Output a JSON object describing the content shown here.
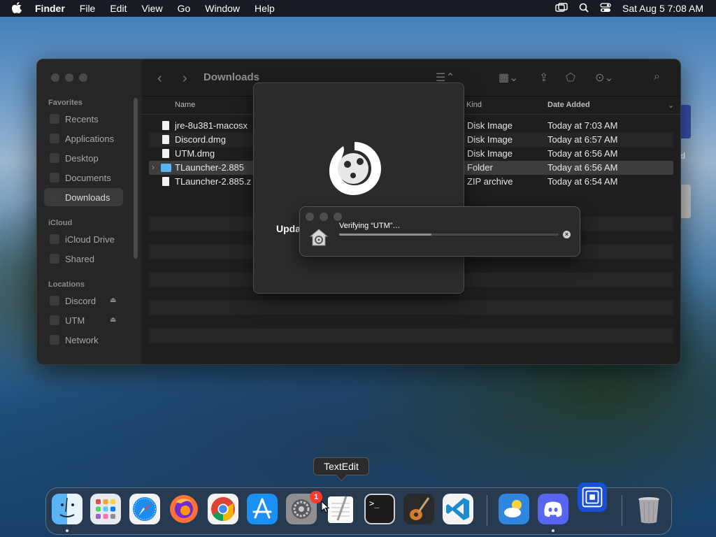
{
  "menubar": {
    "app": "Finder",
    "items": [
      "File",
      "Edit",
      "View",
      "Go",
      "Window",
      "Help"
    ],
    "clock": "Sat Aug 5  7:08 AM"
  },
  "finder": {
    "title": "Downloads",
    "sidebar": {
      "favorites_header": "Favorites",
      "favorites": [
        "Recents",
        "Applications",
        "Desktop",
        "Documents",
        "Downloads"
      ],
      "icloud_header": "iCloud",
      "icloud": [
        "iCloud Drive",
        "Shared"
      ],
      "locations_header": "Locations",
      "locations": [
        "Discord",
        "UTM",
        "Network"
      ]
    },
    "columns": {
      "name": "Name",
      "kind": "Kind",
      "date": "Date Added"
    },
    "files": [
      {
        "name": "jre-8u381-macosx",
        "kind": "Disk Image",
        "date": "Today at 7:03 AM"
      },
      {
        "name": "Discord.dmg",
        "kind": "Disk Image",
        "date": "Today at 6:57 AM"
      },
      {
        "name": "UTM.dmg",
        "kind": "Disk Image",
        "date": "Today at 6:56 AM"
      },
      {
        "name": "TLauncher-2.885",
        "kind": "Folder",
        "date": "Today at 6:56 AM"
      },
      {
        "name": "TLauncher-2.885.z",
        "kind": "ZIP archive",
        "date": "Today at 6:54 AM"
      }
    ]
  },
  "installer": {
    "text": "Upda"
  },
  "verify": {
    "text": "Verifying “UTM”…",
    "progress": 0.42
  },
  "tooltip": "TextEdit",
  "dock": {
    "badge": "1",
    "icons": [
      "finder-icon",
      "launchpad-icon",
      "safari-icon",
      "firefox-icon",
      "chrome-icon",
      "app-store-icon",
      "system-settings-icon",
      "textedit-icon",
      "terminal-icon",
      "garageband-icon",
      "vscode-icon",
      "weather-icon",
      "discord-icon",
      "utm-icon",
      "trash-icon"
    ]
  },
  "colors": {
    "folder": "#5ab3ee",
    "badge": "#ff3b30",
    "vscode": "#1f8ad2",
    "discord": "#5865f2"
  }
}
